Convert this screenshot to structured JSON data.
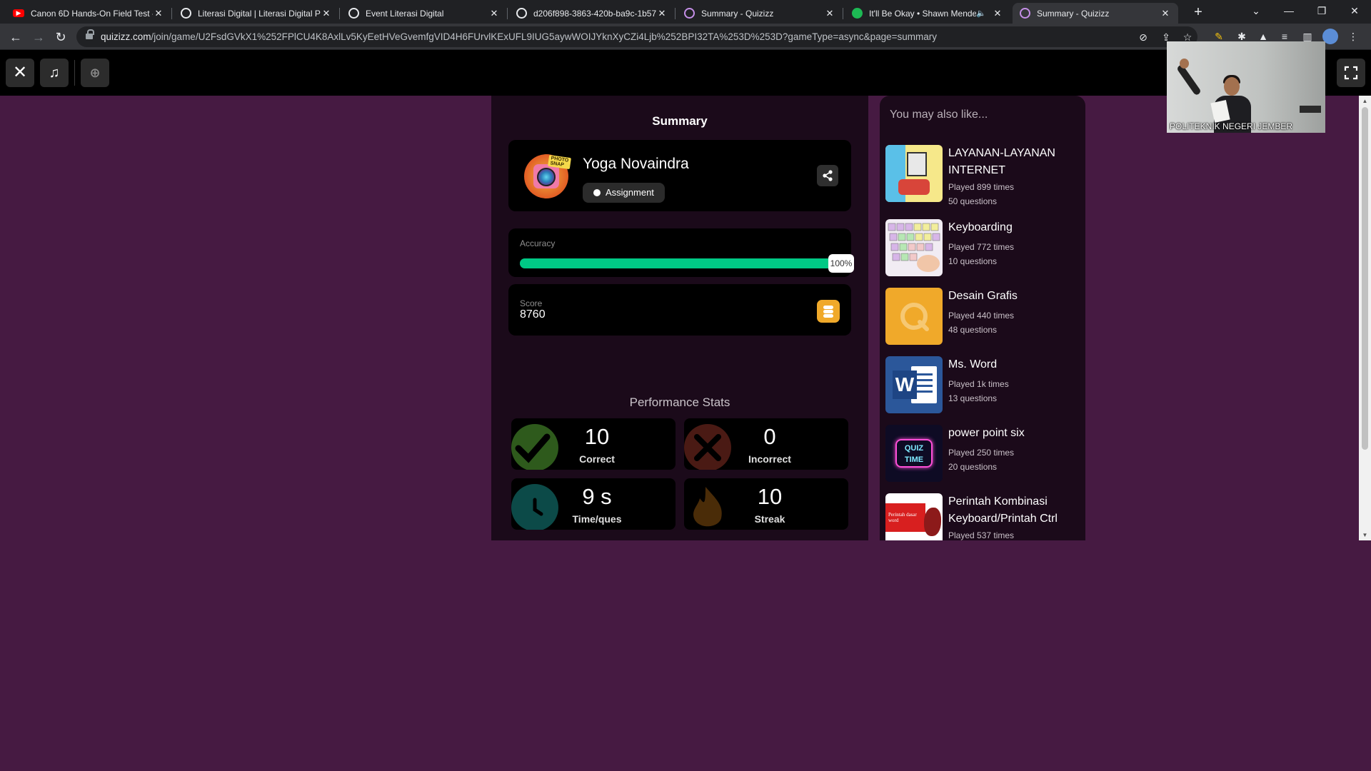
{
  "browser": {
    "tabs": [
      {
        "title": "Canon 6D Hands-On Field Test -",
        "icon": "youtube-icon",
        "color": "#ff0000"
      },
      {
        "title": "Literasi Digital | Literasi Digital P",
        "icon": "globe-icon",
        "color": "#9aa0a6"
      },
      {
        "title": "Event Literasi Digital",
        "icon": "globe-icon",
        "color": "#9aa0a6"
      },
      {
        "title": "d206f898-3863-420b-ba9c-1b57",
        "icon": "globe-icon",
        "color": "#9aa0a6"
      },
      {
        "title": "Summary - Quizizz",
        "icon": "quizizz-icon",
        "color": "#8854c0"
      },
      {
        "title": "It'll Be Okay • Shawn Mende",
        "icon": "spotify-icon",
        "color": "#1db954"
      },
      {
        "title": "Summary - Quizizz",
        "icon": "quizizz-icon",
        "color": "#8854c0"
      }
    ],
    "url_host": "quizizz.com",
    "url_path": "/join/game/U2FsdGVkX1%252FPlCU4K8AxlLv5KyEetHVeGvemfgVID4H6FUrvlKExUFL9IUG5aywWOIJYknXyCZi4Ljb%252BPI32TA%253D%253D?gameType=async&page=summary"
  },
  "webcam": {
    "caption": "POLITEKNIK NEGERI JEMBER"
  },
  "summary": {
    "title": "Summary",
    "player_name": "Yoga Novaindra",
    "mode_badge": "Assignment",
    "avatar_tag": "PHOTO SNAP",
    "accuracy_label": "Accuracy",
    "accuracy_value": "100%",
    "accuracy_fraction": 1.0,
    "score_label": "Score",
    "score_value": "8760",
    "performance_title": "Performance Stats",
    "stats": [
      {
        "value": "10",
        "label": "Correct",
        "color": "#2e5a1c"
      },
      {
        "value": "0",
        "label": "Incorrect",
        "color": "#4a1a14"
      },
      {
        "value": "9 s",
        "label": "Time/ques",
        "color": "#0c4a48"
      },
      {
        "value": "10",
        "label": "Streak",
        "color": "#4a2c08"
      }
    ]
  },
  "recommendations": {
    "title": "You may also like...",
    "items": [
      {
        "title": "LAYANAN-LAYANAN INTERNET",
        "played": "Played 899 times",
        "questions": "50 questions"
      },
      {
        "title": "Keyboarding",
        "played": "Played 772 times",
        "questions": "10 questions"
      },
      {
        "title": "Desain Grafis",
        "played": "Played 440 times",
        "questions": "48 questions"
      },
      {
        "title": "Ms. Word",
        "played": "Played 1k times",
        "questions": "13 questions"
      },
      {
        "title": "power point six",
        "played": "Played 250 times",
        "questions": "20 questions"
      },
      {
        "title": "Perintah Kombinasi Keyboard/Printah Ctrl",
        "played": "Played 537 times",
        "questions": ""
      }
    ],
    "thumb_texts": {
      "word_letter": "W",
      "quiz_time": "QUIZ TIME",
      "perintah_thumb": "Perintah dasar word"
    }
  }
}
